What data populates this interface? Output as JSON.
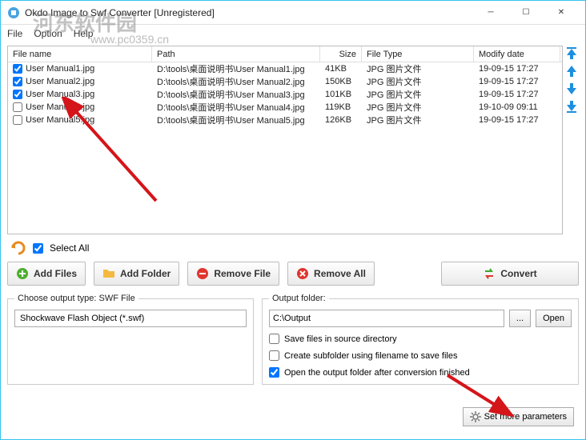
{
  "window": {
    "title": "Okdo Image to Swf Converter [Unregistered]"
  },
  "watermark": {
    "main": "河东软件园",
    "sub": "www.pc0359.cn"
  },
  "menu": {
    "file": "File",
    "option": "Option",
    "help": "Help"
  },
  "columns": {
    "name": "File name",
    "path": "Path",
    "size": "Size",
    "type": "File Type",
    "date": "Modify date"
  },
  "rows": [
    {
      "checked": true,
      "name": "User Manual1.jpg",
      "path": "D:\\tools\\桌面说明书\\User Manual1.jpg",
      "size": "41KB",
      "type": "JPG 图片文件",
      "date": "19-09-15 17:27"
    },
    {
      "checked": true,
      "name": "User Manual2.jpg",
      "path": "D:\\tools\\桌面说明书\\User Manual2.jpg",
      "size": "150KB",
      "type": "JPG 图片文件",
      "date": "19-09-15 17:27"
    },
    {
      "checked": true,
      "name": "User Manual3.jpg",
      "path": "D:\\tools\\桌面说明书\\User Manual3.jpg",
      "size": "101KB",
      "type": "JPG 图片文件",
      "date": "19-09-15 17:27"
    },
    {
      "checked": false,
      "name": "User Manual4.jpg",
      "path": "D:\\tools\\桌面说明书\\User Manual4.jpg",
      "size": "119KB",
      "type": "JPG 图片文件",
      "date": "19-10-09 09:11"
    },
    {
      "checked": false,
      "name": "User Manual5.jpg",
      "path": "D:\\tools\\桌面说明书\\User Manual5.jpg",
      "size": "126KB",
      "type": "JPG 图片文件",
      "date": "19-09-15 17:27"
    }
  ],
  "selectAll": {
    "label": "Select All",
    "checked": true
  },
  "buttons": {
    "addFiles": "Add Files",
    "addFolder": "Add Folder",
    "removeFile": "Remove File",
    "removeAll": "Remove All",
    "convert": "Convert"
  },
  "outputType": {
    "legend": "Choose output type:  SWF File",
    "value": "Shockwave Flash Object (*.swf)"
  },
  "outputFolder": {
    "legend": "Output folder:",
    "path": "C:\\Output",
    "browse": "...",
    "open": "Open",
    "opt1": {
      "label": "Save files in source directory",
      "checked": false
    },
    "opt2": {
      "label": "Create subfolder using filename to save files",
      "checked": false
    },
    "opt3": {
      "label": "Open the output folder after conversion finished",
      "checked": true
    }
  },
  "moreParams": "Set more parameters"
}
